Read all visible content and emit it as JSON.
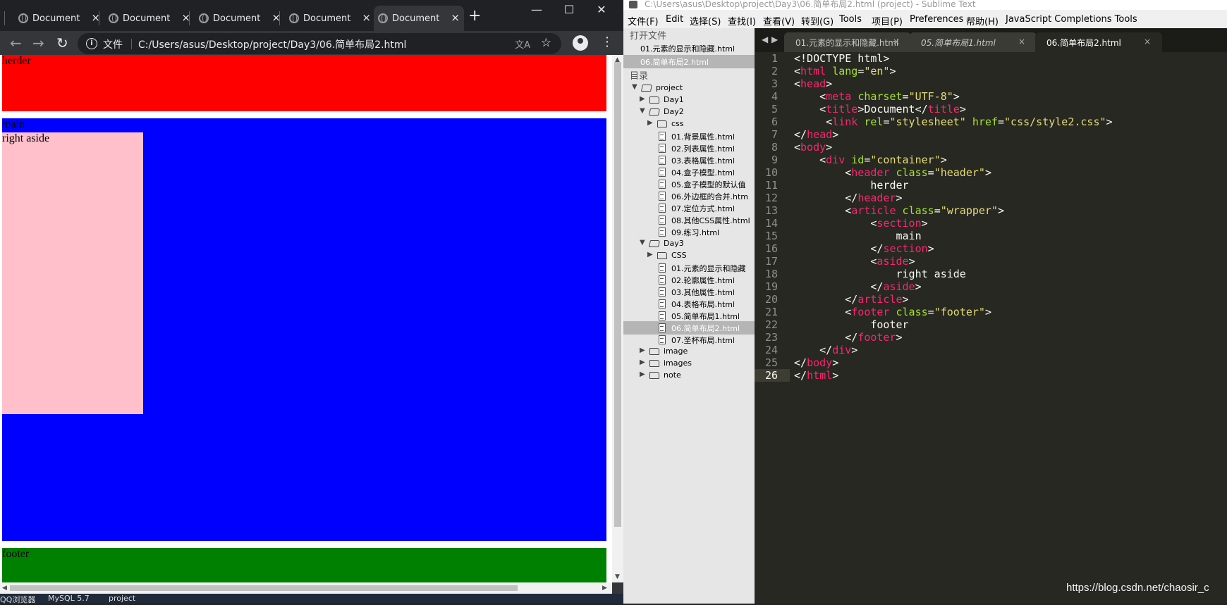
{
  "browser": {
    "tabs": [
      "Document",
      "Document",
      "Document",
      "Document",
      "Document"
    ],
    "tab_close_glyph": "×",
    "new_tab_glyph": "+",
    "window_controls": [
      "—",
      "☐",
      "✕"
    ],
    "address": {
      "file_label": "文件",
      "url": "C:/Users/asus/Desktop/project/Day3/06.简单布局2.html"
    },
    "page": {
      "header": "herder",
      "main": "main",
      "aside": "right aside",
      "footer": "footer"
    },
    "colors": {
      "header": "#ff0000",
      "main": "#0000ff",
      "aside": "#ffc0cb",
      "footer": "#008000"
    }
  },
  "taskbar": [
    "QQ浏览器",
    "MySQL 5.7",
    "project"
  ],
  "sublime": {
    "title": "C:\\Users\\asus\\Desktop\\project\\Day3\\06.简单布局2.html (project) - Sublime Text",
    "menu": [
      "文件(F)",
      "Edit",
      "选择(S)",
      "查找(I)",
      "查看(V)",
      "转到(G)",
      "Tools",
      "项目(P)",
      "Preferences",
      "帮助(H)",
      "JavaScript Completions Tools"
    ],
    "sidebar": {
      "open_files_heading": "打开文件",
      "open_files": [
        "01.元素的显示和隐藏.html",
        "06.简单布局2.html"
      ],
      "folders_heading": "目录",
      "tree": [
        {
          "label": "project",
          "type": "folder",
          "open": true,
          "depth": 0
        },
        {
          "label": "Day1",
          "type": "folder",
          "open": false,
          "depth": 1
        },
        {
          "label": "Day2",
          "type": "folder",
          "open": true,
          "depth": 1
        },
        {
          "label": "css",
          "type": "folder",
          "open": false,
          "depth": 2
        },
        {
          "label": "01.背景属性.html",
          "type": "file",
          "depth": 2
        },
        {
          "label": "02.列表属性.html",
          "type": "file",
          "depth": 2
        },
        {
          "label": "03.表格属性.html",
          "type": "file",
          "depth": 2
        },
        {
          "label": "04.盒子模型.html",
          "type": "file",
          "depth": 2
        },
        {
          "label": "05.盒子模型的默认值",
          "type": "file",
          "depth": 2
        },
        {
          "label": "06.外边框的合并.htm",
          "type": "file",
          "depth": 2
        },
        {
          "label": "07.定位方式.html",
          "type": "file",
          "depth": 2
        },
        {
          "label": "08.其他CSS属性.html",
          "type": "file",
          "depth": 2
        },
        {
          "label": "09.练习.html",
          "type": "file",
          "depth": 2
        },
        {
          "label": "Day3",
          "type": "folder",
          "open": true,
          "depth": 1
        },
        {
          "label": "CSS",
          "type": "folder",
          "open": false,
          "depth": 2
        },
        {
          "label": "01.元素的显示和隐藏",
          "type": "file",
          "depth": 2
        },
        {
          "label": "02.轮廓属性.html",
          "type": "file",
          "depth": 2
        },
        {
          "label": "03.其他属性.html",
          "type": "file",
          "depth": 2
        },
        {
          "label": "04.表格布局.html",
          "type": "file",
          "depth": 2
        },
        {
          "label": "05.简单布局1.html",
          "type": "file",
          "depth": 2
        },
        {
          "label": "06.简单布局2.html",
          "type": "file",
          "depth": 2,
          "selected": true
        },
        {
          "label": "07.圣杯布局.html",
          "type": "file",
          "depth": 2
        },
        {
          "label": "image",
          "type": "folder",
          "open": false,
          "depth": 1
        },
        {
          "label": "images",
          "type": "folder",
          "open": false,
          "depth": 1
        },
        {
          "label": "note",
          "type": "folder",
          "open": false,
          "depth": 1
        }
      ]
    },
    "tabs": [
      {
        "label": "01.元素的显示和隐藏.html",
        "italic": false
      },
      {
        "label": "05.简单布局1.html",
        "italic": true
      },
      {
        "label": "06.简单布局2.html",
        "italic": false,
        "active": true
      }
    ],
    "current_line": 26,
    "code": [
      [
        [
          "pun",
          "<!DOCTYPE html>"
        ]
      ],
      [
        [
          "pun",
          "<"
        ],
        [
          "tag",
          "html"
        ],
        [
          "pun",
          " "
        ],
        [
          "attr",
          "lang"
        ],
        [
          "pun",
          "="
        ],
        [
          "str",
          "\"en\""
        ],
        [
          "pun",
          ">"
        ]
      ],
      [
        [
          "pun",
          "<"
        ],
        [
          "tag",
          "head"
        ],
        [
          "pun",
          ">"
        ]
      ],
      [
        [
          "pun",
          "    <"
        ],
        [
          "tag",
          "meta"
        ],
        [
          "pun",
          " "
        ],
        [
          "attr",
          "charset"
        ],
        [
          "pun",
          "="
        ],
        [
          "str",
          "\"UTF-8\""
        ],
        [
          "pun",
          ">"
        ]
      ],
      [
        [
          "pun",
          "    <"
        ],
        [
          "tag",
          "title"
        ],
        [
          "pun",
          ">Document</"
        ],
        [
          "tag",
          "title"
        ],
        [
          "pun",
          ">"
        ]
      ],
      [
        [
          "pun",
          "     <"
        ],
        [
          "tag",
          "link"
        ],
        [
          "pun",
          " "
        ],
        [
          "attr",
          "rel"
        ],
        [
          "pun",
          "="
        ],
        [
          "str",
          "\"stylesheet\""
        ],
        [
          "pun",
          " "
        ],
        [
          "attr",
          "href"
        ],
        [
          "pun",
          "="
        ],
        [
          "str",
          "\"css/style2.css\""
        ],
        [
          "pun",
          ">"
        ]
      ],
      [
        [
          "pun",
          "</"
        ],
        [
          "tag",
          "head"
        ],
        [
          "pun",
          ">"
        ]
      ],
      [
        [
          "pun",
          "<"
        ],
        [
          "tag",
          "body"
        ],
        [
          "pun",
          ">"
        ]
      ],
      [
        [
          "pun",
          "    <"
        ],
        [
          "tag",
          "div"
        ],
        [
          "pun",
          " "
        ],
        [
          "attr",
          "id"
        ],
        [
          "pun",
          "="
        ],
        [
          "str",
          "\"container\""
        ],
        [
          "pun",
          ">"
        ]
      ],
      [
        [
          "pun",
          "        <"
        ],
        [
          "tag",
          "header"
        ],
        [
          "pun",
          " "
        ],
        [
          "attr",
          "class"
        ],
        [
          "pun",
          "="
        ],
        [
          "str",
          "\"header\""
        ],
        [
          "pun",
          ">"
        ]
      ],
      [
        [
          "pun",
          "            herder"
        ]
      ],
      [
        [
          "pun",
          "        </"
        ],
        [
          "tag",
          "header"
        ],
        [
          "pun",
          ">"
        ]
      ],
      [
        [
          "pun",
          "        <"
        ],
        [
          "tag",
          "article"
        ],
        [
          "pun",
          " "
        ],
        [
          "attr",
          "class"
        ],
        [
          "pun",
          "="
        ],
        [
          "str",
          "\"wrapper\""
        ],
        [
          "pun",
          ">"
        ]
      ],
      [
        [
          "pun",
          "            <"
        ],
        [
          "tag",
          "section"
        ],
        [
          "pun",
          ">"
        ]
      ],
      [
        [
          "pun",
          "                main"
        ]
      ],
      [
        [
          "pun",
          "            </"
        ],
        [
          "tag",
          "section"
        ],
        [
          "pun",
          ">"
        ]
      ],
      [
        [
          "pun",
          "            <"
        ],
        [
          "tag",
          "aside"
        ],
        [
          "pun",
          ">"
        ]
      ],
      [
        [
          "pun",
          "                right aside"
        ]
      ],
      [
        [
          "pun",
          "            </"
        ],
        [
          "tag",
          "aside"
        ],
        [
          "pun",
          ">"
        ]
      ],
      [
        [
          "pun",
          "        </"
        ],
        [
          "tag",
          "article"
        ],
        [
          "pun",
          ">"
        ]
      ],
      [
        [
          "pun",
          "        <"
        ],
        [
          "tag",
          "footer"
        ],
        [
          "pun",
          " "
        ],
        [
          "attr",
          "class"
        ],
        [
          "pun",
          "="
        ],
        [
          "str",
          "\"footer\""
        ],
        [
          "pun",
          ">"
        ]
      ],
      [
        [
          "pun",
          "            footer"
        ]
      ],
      [
        [
          "pun",
          "        </"
        ],
        [
          "tag",
          "footer"
        ],
        [
          "pun",
          ">"
        ]
      ],
      [
        [
          "pun",
          "    </"
        ],
        [
          "tag",
          "div"
        ],
        [
          "pun",
          ">"
        ]
      ],
      [
        [
          "pun",
          "</"
        ],
        [
          "tag",
          "body"
        ],
        [
          "pun",
          ">"
        ]
      ],
      [
        [
          "pun",
          "</"
        ],
        [
          "tag",
          "html"
        ],
        [
          "pun",
          ">"
        ]
      ]
    ]
  },
  "watermark": "https://blog.csdn.net/chaosir_c"
}
